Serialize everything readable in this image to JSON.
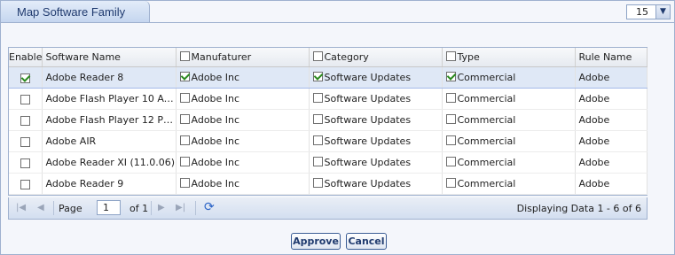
{
  "panel": {
    "title": "Map Software Family"
  },
  "page_size": {
    "value": "15"
  },
  "grid": {
    "headers": {
      "enable": "Enable",
      "software_name": "Software Name",
      "manufacturer": "Manufaturer",
      "category": "Category",
      "type": "Type",
      "rule_name": "Rule Name"
    },
    "rows": [
      {
        "enabled": true,
        "software_name": "Adobe Reader 8",
        "manufacturer": "Adobe Inc",
        "manufacturer_checked": true,
        "category": "Software Updates",
        "category_checked": true,
        "type": "Commercial",
        "type_checked": true,
        "rule_name": "Adobe"
      },
      {
        "enabled": false,
        "software_name": "Adobe Flash Player 10 Acti...",
        "manufacturer": "Adobe Inc",
        "manufacturer_checked": false,
        "category": "Software Updates",
        "category_checked": false,
        "type": "Commercial",
        "type_checked": false,
        "rule_name": "Adobe"
      },
      {
        "enabled": false,
        "software_name": "Adobe Flash Player 12 Plu...",
        "manufacturer": "Adobe Inc",
        "manufacturer_checked": false,
        "category": "Software Updates",
        "category_checked": false,
        "type": "Commercial",
        "type_checked": false,
        "rule_name": "Adobe"
      },
      {
        "enabled": false,
        "software_name": "Adobe AIR",
        "manufacturer": "Adobe Inc",
        "manufacturer_checked": false,
        "category": "Software Updates",
        "category_checked": false,
        "type": "Commercial",
        "type_checked": false,
        "rule_name": "Adobe"
      },
      {
        "enabled": false,
        "software_name": "Adobe Reader XI (11.0.06)",
        "manufacturer": "Adobe Inc",
        "manufacturer_checked": false,
        "category": "Software Updates",
        "category_checked": false,
        "type": "Commercial",
        "type_checked": false,
        "rule_name": "Adobe"
      },
      {
        "enabled": false,
        "software_name": "Adobe Reader 9",
        "manufacturer": "Adobe Inc",
        "manufacturer_checked": false,
        "category": "Software Updates",
        "category_checked": false,
        "type": "Commercial",
        "type_checked": false,
        "rule_name": "Adobe"
      }
    ]
  },
  "pager": {
    "page_label": "Page",
    "page_value": "1",
    "of_label": "of 1",
    "display_info": "Displaying Data 1 - 6 of 6",
    "icons": [
      "first-page-icon",
      "prev-page-icon",
      "next-page-icon",
      "last-page-icon",
      "refresh-icon"
    ]
  },
  "buttons": {
    "approve": "Approve",
    "cancel": "Cancel"
  },
  "colors": {
    "accent": "#1f3a6e",
    "border": "#9fb1cf",
    "selected_row": "#dfe8f6",
    "check": "#2a8a1e"
  }
}
